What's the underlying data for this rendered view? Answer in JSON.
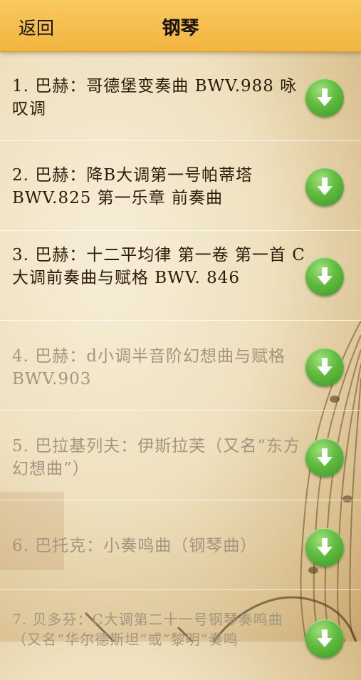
{
  "header": {
    "back_label": "返回",
    "title": "钢琴"
  },
  "items": [
    {
      "text": "1. 巴赫：哥德堡变奏曲 BWV.988 咏叹调"
    },
    {
      "text": "2. 巴赫：降B大调第一号帕蒂塔 BWV.825 第一乐章 前奏曲"
    },
    {
      "text": "3. 巴赫：十二平均律 第一卷 第一首 C大调前奏曲与赋格 BWV. 846"
    },
    {
      "text": "4. 巴赫：d小调半音阶幻想曲与赋格 BWV.903"
    },
    {
      "text": "5. 巴拉基列夫：伊斯拉芙（又名“东方幻想曲”）"
    },
    {
      "text": "6. 巴托克：小奏鸣曲（钢琴曲）"
    },
    {
      "text": "7. 贝多芬：C大调第二十一号钢琴奏鸣曲（又名“华尔德斯坦”或“黎明”奏鸣"
    }
  ],
  "colors": {
    "header": "#f2b53f",
    "download_button": "#5fbb3e"
  }
}
